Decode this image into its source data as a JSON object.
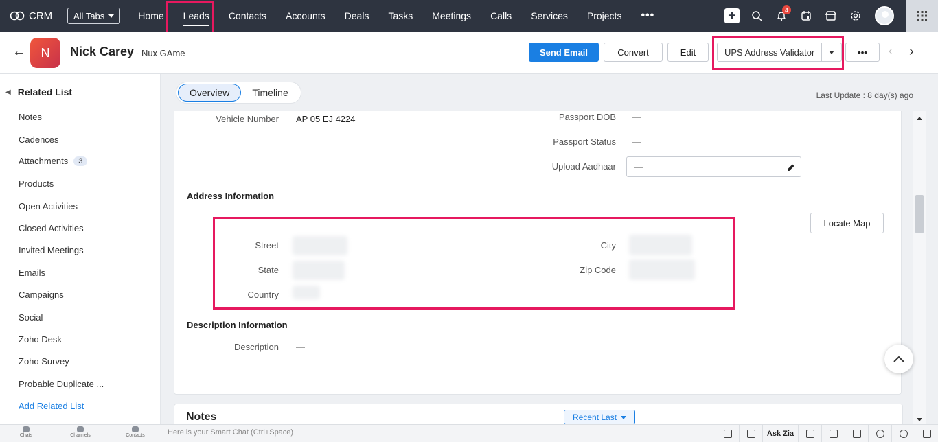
{
  "app": {
    "brand": "CRM",
    "all_tabs": "All Tabs"
  },
  "nav": {
    "tabs": [
      "Home",
      "Leads",
      "Contacts",
      "Accounts",
      "Deals",
      "Tasks",
      "Meetings",
      "Calls",
      "Services",
      "Projects"
    ],
    "active": "Leads",
    "more": "•••",
    "notifications_count": "4"
  },
  "record": {
    "initial": "N",
    "name": "Nick Carey",
    "subtitle": "- Nux GAme",
    "buttons": {
      "send_email": "Send Email",
      "convert": "Convert",
      "edit": "Edit",
      "validator": "UPS Address Validator",
      "more": "•••"
    }
  },
  "sidebar": {
    "title": "Related List",
    "items": [
      {
        "label": "Notes"
      },
      {
        "label": "Cadences"
      },
      {
        "label": "Attachments",
        "count": "3"
      },
      {
        "label": "Products"
      },
      {
        "label": "Open Activities"
      },
      {
        "label": "Closed Activities"
      },
      {
        "label": "Invited Meetings"
      },
      {
        "label": "Emails"
      },
      {
        "label": "Campaigns"
      },
      {
        "label": "Social"
      },
      {
        "label": "Zoho Desk"
      },
      {
        "label": "Zoho Survey"
      },
      {
        "label": "Probable Duplicate ..."
      }
    ],
    "add_link": "Add Related List"
  },
  "view_tabs": {
    "overview": "Overview",
    "timeline": "Timeline"
  },
  "last_update": "Last Update : 8 day(s) ago",
  "details": {
    "vehicle_number_label": "Vehicle Number",
    "vehicle_number_value": "AP 05 EJ 4224",
    "passport_dob_label": "Passport DOB",
    "passport_status_label": "Passport Status",
    "upload_aadhaar_label": "Upload Aadhaar",
    "empty": "—"
  },
  "address": {
    "section": "Address Information",
    "street_label": "Street",
    "state_label": "State",
    "country_label": "Country",
    "city_label": "City",
    "zip_label": "Zip Code",
    "locate_map": "Locate Map"
  },
  "description": {
    "section": "Description Information",
    "label": "Description",
    "value": "—"
  },
  "notes": {
    "title": "Notes",
    "sort": "Recent Last"
  },
  "bottom": {
    "chats": "Chats",
    "channels": "Channels",
    "contacts": "Contacts",
    "smart_chat": "Here is your Smart Chat (Ctrl+Space)",
    "ask_zia": "Ask Zia"
  },
  "colors": {
    "topbar": "#2e3440",
    "primary": "#1a7fe3",
    "highlight": "#e6195f",
    "avatar": "#e0433e"
  }
}
